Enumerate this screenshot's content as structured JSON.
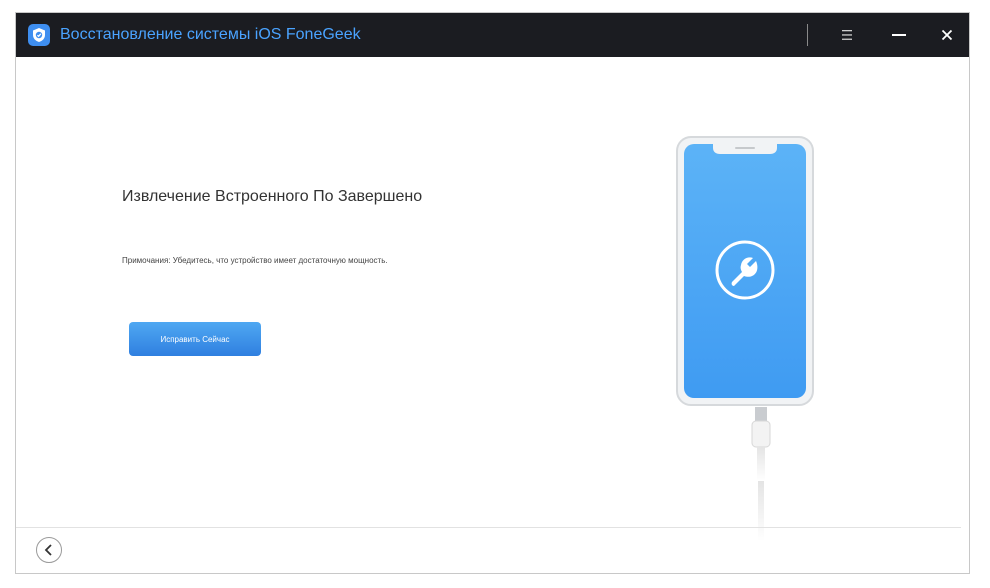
{
  "window": {
    "title": "Восстановление системы iOS FoneGeek"
  },
  "main": {
    "headline": "Извлечение Встроенного По Завершено",
    "note": "Примочания: Убедитесь, что устройство имеет достаточную мощность.",
    "fix_button_label": "Исправить Сейчас"
  },
  "icons": {
    "logo": "shield-logo-icon",
    "menu": "hamburger-menu-icon",
    "minimize": "minimize-icon",
    "close": "close-icon",
    "back": "chevron-left-icon",
    "tool": "wrench-icon"
  },
  "colors": {
    "titlebar_bg": "#1b1c21",
    "title_text": "#4aa3ff",
    "accent": "#2f7fe0",
    "phone_screen": "#4aa3f5"
  }
}
